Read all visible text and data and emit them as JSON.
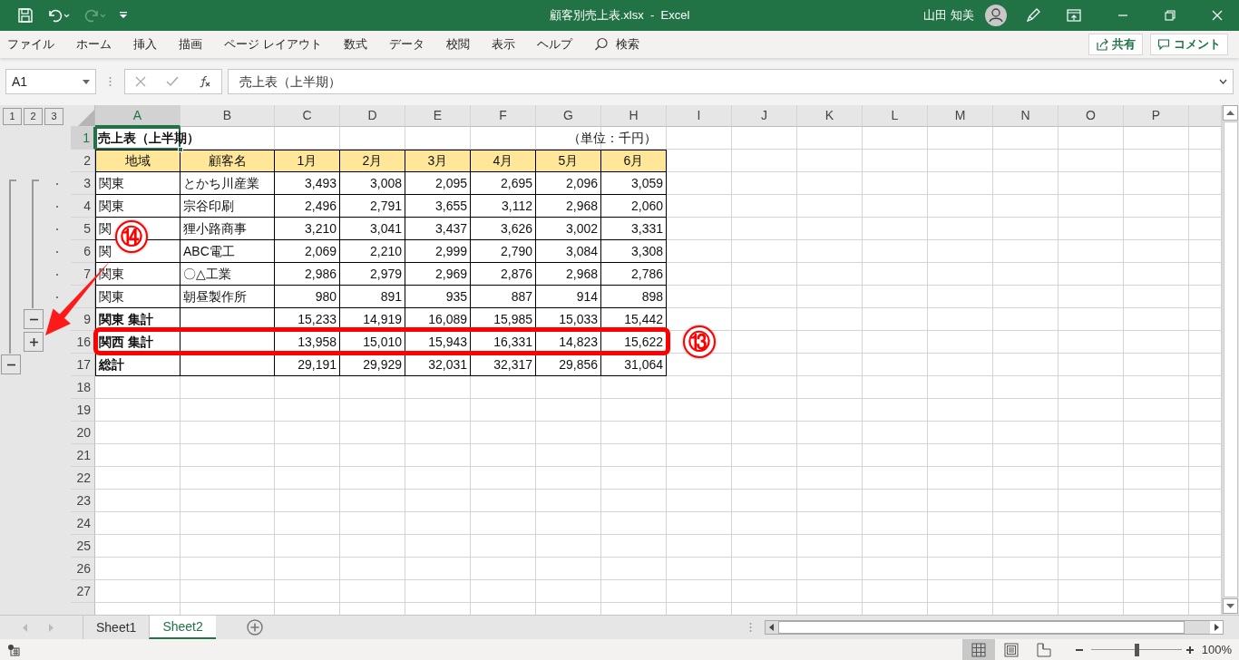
{
  "title_bar": {
    "title": "顧客別売上表.xlsx  -  Excel",
    "user": "山田 知美"
  },
  "ribbon_tabs": [
    {
      "label": "ファイル",
      "selected": false
    },
    {
      "label": "ホーム",
      "selected": false
    },
    {
      "label": "挿入",
      "selected": false
    },
    {
      "label": "描画",
      "selected": false
    },
    {
      "label": "ページ レイアウト",
      "selected": false
    },
    {
      "label": "数式",
      "selected": false
    },
    {
      "label": "データ",
      "selected": false
    },
    {
      "label": "校閲",
      "selected": false
    },
    {
      "label": "表示",
      "selected": false
    },
    {
      "label": "ヘルプ",
      "selected": false
    }
  ],
  "search": {
    "label": "検索"
  },
  "share_button": "共有",
  "comment_button": "コメント",
  "formula_bar": {
    "name_box": "A1",
    "formula": "売上表（上半期）"
  },
  "outline_levels": [
    "1",
    "2",
    "3"
  ],
  "columns": [
    {
      "label": "A",
      "selected": true
    },
    {
      "label": "B",
      "selected": false
    },
    {
      "label": "C",
      "selected": false
    },
    {
      "label": "D",
      "selected": false
    },
    {
      "label": "E",
      "selected": false
    },
    {
      "label": "F",
      "selected": false
    },
    {
      "label": "G",
      "selected": false
    },
    {
      "label": "H",
      "selected": false
    },
    {
      "label": "I",
      "selected": false
    },
    {
      "label": "J",
      "selected": false
    },
    {
      "label": "K",
      "selected": false
    },
    {
      "label": "L",
      "selected": false
    },
    {
      "label": "M",
      "selected": false
    },
    {
      "label": "N",
      "selected": false
    },
    {
      "label": "O",
      "selected": false
    },
    {
      "label": "P",
      "selected": false
    }
  ],
  "rows": [
    {
      "number": "1",
      "kind": "title",
      "selected": true,
      "title": "売上表（上半期）",
      "unit_note": "（単位：千円）"
    },
    {
      "number": "2",
      "kind": "header",
      "selected": false,
      "cells": [
        "地域",
        "顧客名",
        "1月",
        "2月",
        "3月",
        "4月",
        "5月",
        "6月"
      ]
    },
    {
      "number": "3",
      "kind": "data",
      "selected": false,
      "outline": {
        "kind": "detail"
      },
      "cells": [
        "関東",
        "とかち川産業",
        "3,493",
        "3,008",
        "2,095",
        "2,695",
        "2,096",
        "3,059"
      ]
    },
    {
      "number": "4",
      "kind": "data",
      "selected": false,
      "outline": {
        "kind": "detail"
      },
      "cells": [
        "関東",
        "宗谷印刷",
        "2,496",
        "2,791",
        "3,655",
        "3,112",
        "2,968",
        "2,060"
      ]
    },
    {
      "number": "5",
      "kind": "data",
      "selected": false,
      "outline": {
        "kind": "detail"
      },
      "cells": [
        "関",
        "狸小路商事",
        "3,210",
        "3,041",
        "3,437",
        "3,626",
        "3,002",
        "3,331"
      ]
    },
    {
      "number": "6",
      "kind": "data",
      "selected": false,
      "outline": {
        "kind": "detail"
      },
      "cells": [
        "関",
        "ABC電工",
        "2,069",
        "2,210",
        "2,999",
        "2,790",
        "3,084",
        "3,308"
      ]
    },
    {
      "number": "7",
      "kind": "data",
      "selected": false,
      "outline": {
        "kind": "detail"
      },
      "cells": [
        "関東",
        "〇△工業",
        "2,986",
        "2,979",
        "2,969",
        "2,876",
        "2,968",
        "2,786"
      ]
    },
    {
      "kind": "data",
      "selected": false,
      "outline": {
        "kind": "detail"
      },
      "cells": [
        "関東",
        "朝昼製作所",
        "980",
        "891",
        "935",
        "887",
        "914",
        "898"
      ]
    },
    {
      "number": "9",
      "kind": "subtotal",
      "selected": false,
      "outline": {
        "kind": "collapse_inner"
      },
      "label": "関東 集計",
      "values": [
        "15,233",
        "14,919",
        "16,089",
        "15,985",
        "15,033",
        "15,442"
      ]
    },
    {
      "number": "16",
      "kind": "subtotal",
      "selected": false,
      "outline": {
        "kind": "expand_inner"
      },
      "highlighted": true,
      "label": "関西 集計",
      "values": [
        "13,958",
        "15,010",
        "15,943",
        "16,331",
        "14,823",
        "15,622"
      ]
    },
    {
      "number": "17",
      "kind": "subtotal",
      "selected": false,
      "outline": {
        "kind": "collapse_outer"
      },
      "label": "総計",
      "values": [
        "29,191",
        "29,929",
        "32,031",
        "32,317",
        "29,856",
        "31,064"
      ]
    },
    {
      "number": "18",
      "kind": "empty",
      "selected": false
    },
    {
      "number": "19",
      "kind": "empty",
      "selected": false
    },
    {
      "number": "20",
      "kind": "empty",
      "selected": false
    },
    {
      "number": "21",
      "kind": "empty",
      "selected": false
    },
    {
      "number": "22",
      "kind": "empty",
      "selected": false
    },
    {
      "number": "23",
      "kind": "empty",
      "selected": false
    },
    {
      "number": "24",
      "kind": "empty",
      "selected": false
    },
    {
      "number": "25",
      "kind": "empty",
      "selected": false
    },
    {
      "number": "26",
      "kind": "empty",
      "selected": false
    },
    {
      "number": "27",
      "kind": "empty",
      "selected": false
    }
  ],
  "annotations": [
    {
      "kind": "expand_callout",
      "text": "⑭"
    },
    {
      "kind": "row_callout",
      "text": "⑬"
    }
  ],
  "sheet_tabs": [
    {
      "label": "Sheet1",
      "selected": false
    },
    {
      "label": "Sheet2",
      "selected": true
    }
  ],
  "status_bar": {
    "views": [
      {
        "kind": "normal",
        "selected": true
      },
      {
        "kind": "page_layout",
        "selected": false
      },
      {
        "kind": "page_break",
        "selected": false
      }
    ],
    "zoom": {
      "level": 0.5,
      "reading": "100%"
    }
  }
}
